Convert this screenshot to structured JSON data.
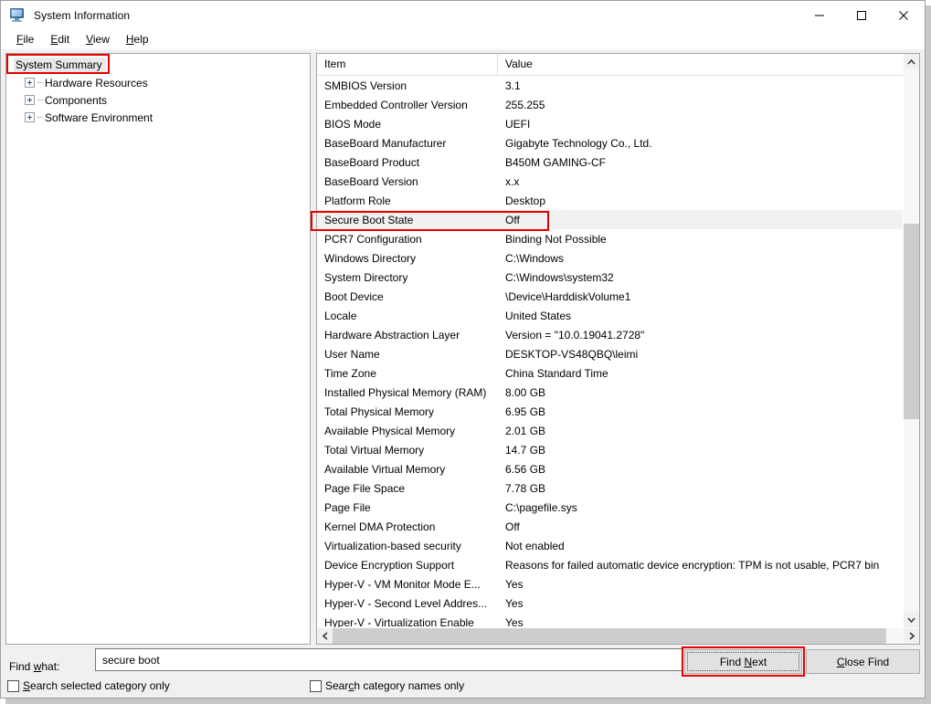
{
  "window": {
    "title": "System Information",
    "icon": "computer-monitor-icon",
    "controls": {
      "minimize": "minimize-icon",
      "maximize": "maximize-icon",
      "close": "close-icon"
    }
  },
  "menubar": {
    "items": [
      {
        "label": "File",
        "accel": "F"
      },
      {
        "label": "Edit",
        "accel": "E"
      },
      {
        "label": "View",
        "accel": "V"
      },
      {
        "label": "Help",
        "accel": "H"
      }
    ]
  },
  "tree": {
    "nodes": [
      {
        "label": "System Summary",
        "expandable": false,
        "selected": true
      },
      {
        "label": "Hardware Resources",
        "expandable": true,
        "selected": false
      },
      {
        "label": "Components",
        "expandable": true,
        "selected": false
      },
      {
        "label": "Software Environment",
        "expandable": true,
        "selected": false
      }
    ]
  },
  "list": {
    "columns": [
      "Item",
      "Value"
    ],
    "rows": [
      {
        "item": "SMBIOS Version",
        "value": "3.1"
      },
      {
        "item": "Embedded Controller Version",
        "value": "255.255"
      },
      {
        "item": "BIOS Mode",
        "value": "UEFI"
      },
      {
        "item": "BaseBoard Manufacturer",
        "value": "Gigabyte Technology Co., Ltd."
      },
      {
        "item": "BaseBoard Product",
        "value": "B450M GAMING-CF"
      },
      {
        "item": "BaseBoard Version",
        "value": "x.x"
      },
      {
        "item": "Platform Role",
        "value": "Desktop"
      },
      {
        "item": "Secure Boot State",
        "value": "Off",
        "highlight": true
      },
      {
        "item": "PCR7 Configuration",
        "value": "Binding Not Possible"
      },
      {
        "item": "Windows Directory",
        "value": "C:\\Windows"
      },
      {
        "item": "System Directory",
        "value": "C:\\Windows\\system32"
      },
      {
        "item": "Boot Device",
        "value": "\\Device\\HarddiskVolume1"
      },
      {
        "item": "Locale",
        "value": "United States"
      },
      {
        "item": "Hardware Abstraction Layer",
        "value": "Version = \"10.0.19041.2728\""
      },
      {
        "item": "User Name",
        "value": "DESKTOP-VS48QBQ\\leimi"
      },
      {
        "item": "Time Zone",
        "value": "China Standard Time"
      },
      {
        "item": "Installed Physical Memory (RAM)",
        "value": "8.00 GB"
      },
      {
        "item": "Total Physical Memory",
        "value": "6.95 GB"
      },
      {
        "item": "Available Physical Memory",
        "value": "2.01 GB"
      },
      {
        "item": "Total Virtual Memory",
        "value": "14.7 GB"
      },
      {
        "item": "Available Virtual Memory",
        "value": "6.56 GB"
      },
      {
        "item": "Page File Space",
        "value": "7.78 GB"
      },
      {
        "item": "Page File",
        "value": "C:\\pagefile.sys"
      },
      {
        "item": "Kernel DMA Protection",
        "value": "Off"
      },
      {
        "item": "Virtualization-based security",
        "value": "Not enabled"
      },
      {
        "item": "Device Encryption Support",
        "value": "Reasons for failed automatic device encryption: TPM is not usable, PCR7 bin"
      },
      {
        "item": "Hyper-V - VM Monitor Mode E...",
        "value": "Yes"
      },
      {
        "item": "Hyper-V - Second Level Addres...",
        "value": "Yes"
      },
      {
        "item": "Hyper-V - Virtualization Enable",
        "value": "Yes"
      }
    ]
  },
  "scrollbars": {
    "vertical": {
      "up_icon": "chevron-up-icon",
      "down_icon": "chevron-down-icon"
    },
    "horizontal": {
      "left_icon": "chevron-left-icon",
      "right_icon": "chevron-right-icon"
    }
  },
  "findbar": {
    "label": "Find what:",
    "label_accel": "w",
    "input_value": "secure boot",
    "input_placeholder": "",
    "find_next": "Find Next",
    "find_next_accel": "N",
    "close_find": "Close Find",
    "close_find_accel": "C",
    "checkbox_selected_category": "Search selected category only",
    "checkbox_selected_category_accel": "S",
    "checkbox_selected_category_checked": false,
    "checkbox_category_names": "Search category names only",
    "checkbox_category_names_accel": "c",
    "checkbox_category_names_checked": false
  },
  "annotations": {
    "color": "#e60000",
    "boxes": [
      {
        "name": "system-summary-highlight"
      },
      {
        "name": "secure-boot-row-highlight"
      },
      {
        "name": "find-next-highlight"
      }
    ]
  }
}
